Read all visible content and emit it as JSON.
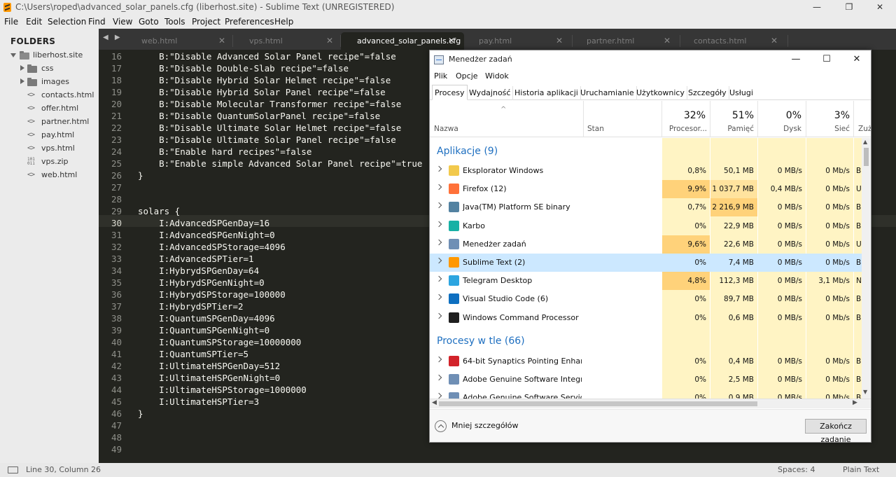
{
  "window": {
    "title": "C:\\Users\\roped\\advanced_solar_panels.cfg (liberhost.site) - Sublime Text (UNREGISTERED)",
    "minimize": "—",
    "maximize": "❐",
    "close": "✕"
  },
  "menu": [
    "File",
    "Edit",
    "Selection",
    "Find",
    "View",
    "Goto",
    "Tools",
    "Project",
    "Preferences",
    "Help"
  ],
  "sidebar": {
    "label": "FOLDERS",
    "root": "liberhost.site",
    "items": [
      {
        "label": "css",
        "kind": "folder"
      },
      {
        "label": "images",
        "kind": "folder"
      },
      {
        "label": "contacts.html",
        "kind": "code"
      },
      {
        "label": "offer.html",
        "kind": "code"
      },
      {
        "label": "partner.html",
        "kind": "code"
      },
      {
        "label": "pay.html",
        "kind": "code"
      },
      {
        "label": "vps.html",
        "kind": "code"
      },
      {
        "label": "vps.zip",
        "kind": "binary"
      },
      {
        "label": "web.html",
        "kind": "code"
      }
    ]
  },
  "tabs": {
    "nav": "◀ ▶",
    "items": [
      {
        "label": "web.html",
        "close": "✕"
      },
      {
        "label": "vps.html",
        "close": "✕"
      },
      {
        "label": "advanced_solar_panels.cfg",
        "close": "✕",
        "active": true
      },
      {
        "label": "pay.html",
        "close": "✕"
      },
      {
        "label": "partner.html",
        "close": "✕"
      },
      {
        "label": "contacts.html",
        "close": "✕"
      }
    ]
  },
  "editor": {
    "current_line": 30,
    "lines": [
      {
        "n": "16",
        "t": "    B:\"Disable Advanced Solar Panel recipe\"=false"
      },
      {
        "n": "17",
        "t": "    B:\"Disable Double-Slab recipe\"=false"
      },
      {
        "n": "18",
        "t": "    B:\"Disable Hybrid Solar Helmet recipe\"=false"
      },
      {
        "n": "19",
        "t": "    B:\"Disable Hybrid Solar Panel recipe\"=false"
      },
      {
        "n": "20",
        "t": "    B:\"Disable Molecular Transformer recipe\"=false"
      },
      {
        "n": "21",
        "t": "    B:\"Disable QuantumSolarPanel recipe\"=false"
      },
      {
        "n": "22",
        "t": "    B:\"Disable Ultimate Solar Helmet recipe\"=false"
      },
      {
        "n": "23",
        "t": "    B:\"Disable Ultimate Solar Panel recipe\"=false"
      },
      {
        "n": "24",
        "t": "    B:\"Enable hard recipes\"=false"
      },
      {
        "n": "25",
        "t": "    B:\"Enable simple Advanced Solar Panel recipe\"=true"
      },
      {
        "n": "26",
        "t": "}"
      },
      {
        "n": "27",
        "t": ""
      },
      {
        "n": "28",
        "t": ""
      },
      {
        "n": "29",
        "t": "solars {"
      },
      {
        "n": "30",
        "t": "    I:AdvancedSPGenDay=16"
      },
      {
        "n": "31",
        "t": "    I:AdvancedSPGenNight=0"
      },
      {
        "n": "32",
        "t": "    I:AdvancedSPStorage=4096"
      },
      {
        "n": "33",
        "t": "    I:AdvancedSPTier=1"
      },
      {
        "n": "34",
        "t": "    I:HybrydSPGenDay=64"
      },
      {
        "n": "35",
        "t": "    I:HybrydSPGenNight=0"
      },
      {
        "n": "36",
        "t": "    I:HybrydSPStorage=100000"
      },
      {
        "n": "37",
        "t": "    I:HybrydSPTier=2"
      },
      {
        "n": "38",
        "t": "    I:QuantumSPGenDay=4096"
      },
      {
        "n": "39",
        "t": "    I:QuantumSPGenNight=0"
      },
      {
        "n": "40",
        "t": "    I:QuantumSPStorage=10000000"
      },
      {
        "n": "41",
        "t": "    I:QuantumSPTier=5"
      },
      {
        "n": "42",
        "t": "    I:UltimateHSPGenDay=512"
      },
      {
        "n": "43",
        "t": "    I:UltimateHSPGenNight=0"
      },
      {
        "n": "44",
        "t": "    I:UltimateHSPStorage=1000000"
      },
      {
        "n": "45",
        "t": "    I:UltimateHSPTier=3"
      },
      {
        "n": "46",
        "t": "}"
      },
      {
        "n": "47",
        "t": ""
      },
      {
        "n": "48",
        "t": ""
      },
      {
        "n": "49",
        "t": ""
      }
    ]
  },
  "status": {
    "position": "Line 30, Column 26",
    "spaces": "Spaces: 4",
    "syntax": "Plain Text"
  },
  "taskmgr": {
    "title": "Menedżer zadań",
    "controls": {
      "min": "—",
      "max": "☐",
      "close": "✕"
    },
    "menu": [
      "Plik",
      "Opcje",
      "Widok"
    ],
    "tabs": [
      "Procesy",
      "Wydajność",
      "Historia aplikacji",
      "Uruchamianie",
      "Użytkownicy",
      "Szczegóły",
      "Usługi"
    ],
    "sort_chevron": "^",
    "columns": {
      "name": "Nazwa",
      "status": "Stan",
      "cpu": {
        "pct": "32%",
        "label": "Procesor..."
      },
      "mem": {
        "pct": "51%",
        "label": "Pamięć"
      },
      "disk": {
        "pct": "0%",
        "label": "Dysk"
      },
      "net": {
        "pct": "3%",
        "label": "Sieć"
      },
      "power": {
        "label": "Zuż"
      }
    },
    "groups": {
      "apps": "Aplikacje (9)",
      "background": "Procesy w tle (66)"
    },
    "apps": [
      {
        "name": "Eksplorator Windows",
        "icon": "folder-icon",
        "color": "#f2c94c",
        "cpu": "0,8%",
        "mem": "50,1 MB",
        "disk": "0 MB/s",
        "net": "0 Mb/s",
        "pw": "B"
      },
      {
        "name": "Firefox (12)",
        "icon": "firefox-icon",
        "color": "#ff7139",
        "cpu": "9,9%",
        "mem": "1 037,7 MB",
        "disk": "0,4 MB/s",
        "net": "0 Mb/s",
        "pw": "U"
      },
      {
        "name": "Java(TM) Platform SE binary",
        "icon": "java-icon",
        "color": "#5382a1",
        "cpu": "0,7%",
        "mem": "2 216,9 MB",
        "disk": "0 MB/s",
        "net": "0 Mb/s",
        "pw": "B"
      },
      {
        "name": "Karbo",
        "icon": "karbo-icon",
        "color": "#18b1a5",
        "cpu": "0%",
        "mem": "22,9 MB",
        "disk": "0 MB/s",
        "net": "0 Mb/s",
        "pw": "B"
      },
      {
        "name": "Menedżer zadań",
        "icon": "task-manager-icon",
        "color": "#6f8fb5",
        "cpu": "9,6%",
        "mem": "22,6 MB",
        "disk": "0 MB/s",
        "net": "0 Mb/s",
        "pw": "U"
      },
      {
        "name": "Sublime Text (2)",
        "icon": "sublime-icon",
        "color": "#ff9800",
        "cpu": "0%",
        "mem": "7,4 MB",
        "disk": "0 MB/s",
        "net": "0 Mb/s",
        "pw": "B"
      },
      {
        "name": "Telegram Desktop",
        "icon": "telegram-icon",
        "color": "#2ca5e0",
        "cpu": "4,8%",
        "mem": "112,3 MB",
        "disk": "0 MB/s",
        "net": "3,1 Mb/s",
        "pw": "N"
      },
      {
        "name": "Visual Studio Code (6)",
        "icon": "vscode-icon",
        "color": "#0e6fc0",
        "cpu": "0%",
        "mem": "89,7 MB",
        "disk": "0 MB/s",
        "net": "0 Mb/s",
        "pw": "B"
      },
      {
        "name": "Windows Command Processor ...",
        "icon": "cmd-icon",
        "color": "#1f1f1f",
        "cpu": "0%",
        "mem": "0,6 MB",
        "disk": "0 MB/s",
        "net": "0 Mb/s",
        "pw": "B"
      }
    ],
    "background": [
      {
        "name": "64-bit Synaptics Pointing Enhan...",
        "icon": "synaptics-icon",
        "color": "#d2232a",
        "cpu": "0%",
        "mem": "0,4 MB",
        "disk": "0 MB/s",
        "net": "0 Mb/s",
        "pw": "B"
      },
      {
        "name": "Adobe Genuine Software Integri...",
        "icon": "app-window-icon",
        "color": "#6f8fb5",
        "cpu": "0%",
        "mem": "2,5 MB",
        "disk": "0 MB/s",
        "net": "0 Mb/s",
        "pw": "B"
      },
      {
        "name": "Adobe Genuine Software Servic...",
        "icon": "app-window-icon",
        "color": "#6f8fb5",
        "cpu": "0%",
        "mem": "0,9 MB",
        "disk": "0 MB/s",
        "net": "0 Mb/s",
        "pw": "B"
      }
    ],
    "less_details": "Mniej szczegółów",
    "end_task": "Zakończ zadanie"
  }
}
